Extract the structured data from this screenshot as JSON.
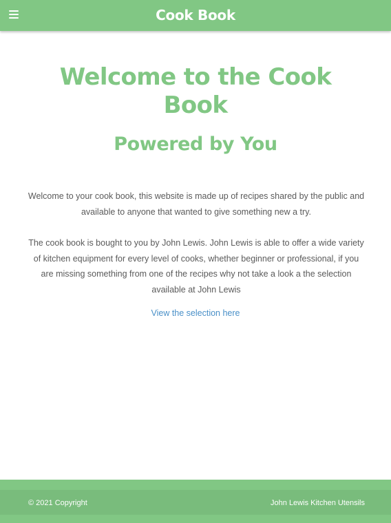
{
  "header": {
    "brand": "Cook Book",
    "menu_icon": "hamburger-menu-icon"
  },
  "main": {
    "welcome_line1": "Welcome to the Cook",
    "welcome_line2": "Book",
    "subtitle": "Powered by You",
    "paragraph1": "Welcome to your cook book, this website is made up of recipes shared by the public and available to anyone that wanted to give something new a try.",
    "paragraph2": "The cook book is bought to you by John Lewis. John Lewis is able to offer a wide variety of kitchen equipment for every level of cooks, whether beginner or professional, if you are missing something from one of the recipes why not take a look a the selection available at John Lewis",
    "link_text": "View the selection here"
  },
  "footer": {
    "copyright": "© 2021 Copyright",
    "link_text": "John Lewis Kitchen Utensils"
  },
  "colors": {
    "brand_green": "#81c784",
    "link_blue": "#4a90c8",
    "body_text": "#5a5a5a"
  }
}
